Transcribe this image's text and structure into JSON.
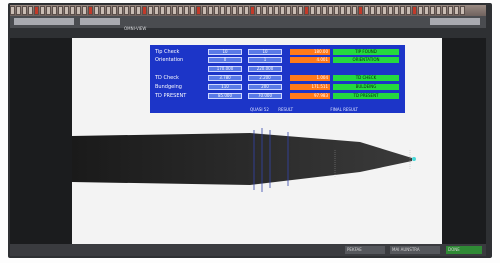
{
  "screen": {
    "title": "OMNI-VIEW"
  },
  "panel": {
    "rows": [
      {
        "label": "Tip Check",
        "left_value": "10",
        "right_value": "10",
        "result": "180.00",
        "status": "TIP FOUND"
      },
      {
        "label": "Orientation",
        "left_value": "0",
        "right_value": "1",
        "result": "4.001",
        "status": "ORIENTATION"
      },
      {
        "label": "",
        "left_value": "170.000",
        "right_value": "220.000",
        "result": "",
        "status": ""
      },
      {
        "label": "TD Check",
        "left_value": "3.780",
        "right_value": "2.200",
        "result": "1.004",
        "status": "TD CHECK"
      },
      {
        "label": "Bundgeing",
        "left_value": "110",
        "right_value": "200",
        "result": "171.511",
        "status": "BULDEING"
      },
      {
        "label": "TD PRESENT",
        "left_value": "85.000",
        "right_value": "70.000",
        "result": "97.983",
        "status": "TD PRESENT"
      }
    ],
    "footer_left": "QUASI 52",
    "footer_mid": "RESULT",
    "footer_right": "FINAL RESULT"
  },
  "statusbar": {
    "cells": [
      "PEKFAE",
      "MAI AUNSTRA",
      "DONE"
    ]
  },
  "colors": {
    "panel_bg": "#1c35c8",
    "orange": "#ff7a1a",
    "green": "#25d93f",
    "dark": "#1b1c1e"
  }
}
